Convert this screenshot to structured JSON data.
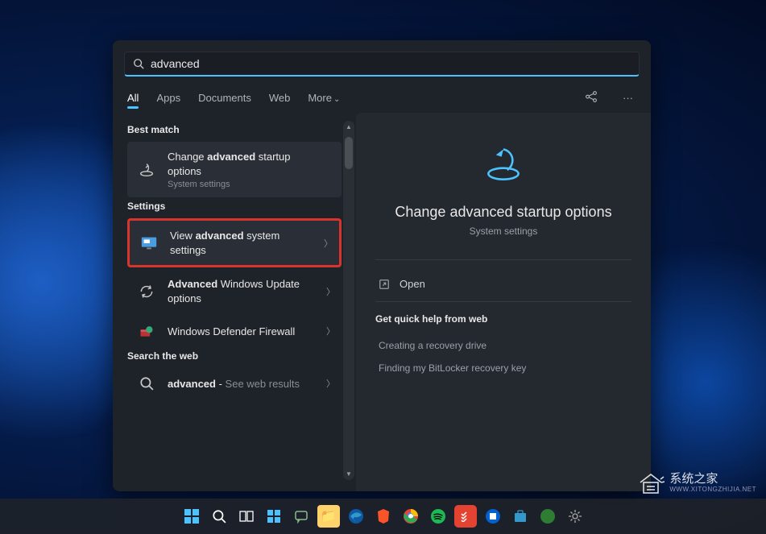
{
  "search": {
    "query": "advanced"
  },
  "tabs": {
    "all": "All",
    "apps": "Apps",
    "documents": "Documents",
    "web": "Web",
    "more": "More"
  },
  "sections": {
    "best_match": "Best match",
    "settings": "Settings",
    "search_web": "Search the web"
  },
  "results": {
    "best_match": {
      "title_pre": "Change ",
      "title_bold": "advanced",
      "title_post": " startup options",
      "sub": "System settings"
    },
    "settings": [
      {
        "pre": "View ",
        "bold": "advanced",
        "post": " system settings",
        "sub": ""
      },
      {
        "pre": "",
        "bold": "Advanced",
        "post": " Windows Update options",
        "sub": ""
      },
      {
        "pre": "",
        "bold": "",
        "post": "Windows Defender Firewall",
        "sub": ""
      }
    ],
    "web": {
      "pre": "",
      "bold": "advanced",
      "post": "",
      "sub": "See web results"
    }
  },
  "preview": {
    "title": "Change advanced startup options",
    "sub": "System settings",
    "open": "Open",
    "quick_help_header": "Get quick help from web",
    "links": [
      "Creating a recovery drive",
      "Finding my BitLocker recovery key"
    ]
  },
  "watermark": {
    "cn": "系统之家",
    "en": "WWW.XITONGZHIJIA.NET"
  }
}
